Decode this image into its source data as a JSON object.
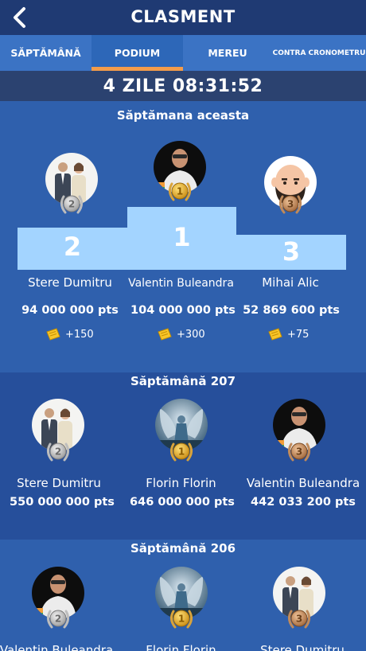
{
  "header": {
    "title": "CLASMENT",
    "back_icon": "back-chevron-icon"
  },
  "tabs": [
    {
      "label": "SĂPTĂMÂNĂ",
      "active": false
    },
    {
      "label": "PODIUM",
      "active": true
    },
    {
      "label": "MEREU",
      "active": false
    },
    {
      "label": "CONTRA CRONOMETRU",
      "active": false
    }
  ],
  "timer": "4 ZILE 08:31:52",
  "colors": {
    "accent": "#f39c4a",
    "podium": "#a3d4ff",
    "header": "#1f3a73"
  },
  "current_week": {
    "title": "Săptămana aceasta",
    "podium_numbers": [
      "2",
      "1",
      "3"
    ],
    "players": [
      {
        "rank": "2",
        "name": "Stere Dumitru",
        "points": "94 000 000 pts",
        "bonus": "+150"
      },
      {
        "rank": "1",
        "name": "Valentin Buleandra",
        "points": "104 000 000 pts",
        "bonus": "+300"
      },
      {
        "rank": "3",
        "name": "Mihai Alic",
        "points": "52 869 600 pts",
        "bonus": "+75"
      }
    ]
  },
  "week_207": {
    "title": "Săptămână 207",
    "players": [
      {
        "rank": "2",
        "name": "Stere Dumitru",
        "points": "550 000 000 pts"
      },
      {
        "rank": "1",
        "name": "Florin Florin",
        "points": "646 000 000 pts"
      },
      {
        "rank": "3",
        "name": "Valentin Buleandra",
        "points": "442 033 200 pts"
      }
    ]
  },
  "week_206": {
    "title": "Săptămână 206",
    "players": [
      {
        "rank": "2",
        "name": "Valentin Buleandra"
      },
      {
        "rank": "1",
        "name": "Florin Florin"
      },
      {
        "rank": "3",
        "name": "Stere Dumitru"
      }
    ]
  }
}
